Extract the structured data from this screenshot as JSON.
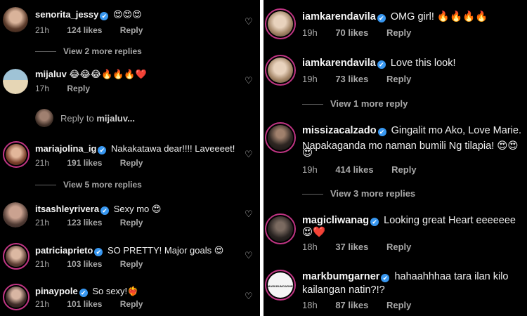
{
  "left": {
    "comments": [
      {
        "username": "senorita_jessy",
        "text": "😍😍😍",
        "time": "21h",
        "likes": "124 likes",
        "reply": "Reply"
      },
      {
        "username": "mijaluv",
        "text": "😂😂😂🔥🔥🔥❤️",
        "time": "17h",
        "likes": "",
        "reply": "Reply"
      },
      {
        "username": "mariajolina_ig",
        "text": "Nakakatawa dear!!!! Laveeeet!",
        "time": "21h",
        "likes": "191 likes",
        "reply": "Reply"
      },
      {
        "username": "itsashleyrivera",
        "text": "Sexy mo 😍",
        "time": "21h",
        "likes": "123 likes",
        "reply": "Reply"
      },
      {
        "username": "patriciaprieto",
        "text": "SO PRETTY! Major goals 😍",
        "time": "21h",
        "likes": "103 likes",
        "reply": "Reply"
      },
      {
        "username": "pinaypole",
        "text": "So sexy!❤️‍🔥",
        "time": "21h",
        "likes": "101 likes",
        "reply": "Reply"
      }
    ],
    "view_more_1": "View 2 more replies",
    "reply_to_prefix": "Reply to ",
    "reply_to_user": "mijaluv...",
    "view_more_2": "View 5 more replies"
  },
  "right": {
    "comments": [
      {
        "username": "iamkarendavila",
        "text": "OMG girl! 🔥🔥🔥🔥",
        "time": "19h",
        "likes": "70 likes",
        "reply": "Reply"
      },
      {
        "username": "iamkarendavila",
        "text": "Love this look!",
        "time": "19h",
        "likes": "73 likes",
        "reply": "Reply"
      },
      {
        "username": "missizacalzado",
        "text": "Gingalit mo Ako, Love Marie.",
        "text2": "Napakaganda mo naman bumili Ng tilapia! 😍😍",
        "text3": "😍",
        "time": "19h",
        "likes": "414 likes",
        "reply": "Reply"
      },
      {
        "username": "magicliwanag",
        "text": "Looking great Heart eeeeeee",
        "text2": "😍❤️",
        "time": "18h",
        "likes": "37 likes",
        "reply": "Reply"
      },
      {
        "username": "markbumgarner",
        "text": "hahaahhhaa tara ilan kilo",
        "text2": "kailangan natin?!?",
        "time": "18h",
        "likes": "87 likes",
        "reply": "Reply"
      }
    ],
    "view_more_1": "View 1 more reply",
    "view_more_2": "View 3 more replies",
    "mb_avatar_text": "MARKBUMGARNER"
  },
  "icons": {
    "verified": "✔",
    "heart": "♡"
  },
  "colors": {
    "background": "#000000",
    "verified_blue": "#3897f0",
    "story_ring": "#c13584",
    "muted_text": "#a8a8a8"
  }
}
